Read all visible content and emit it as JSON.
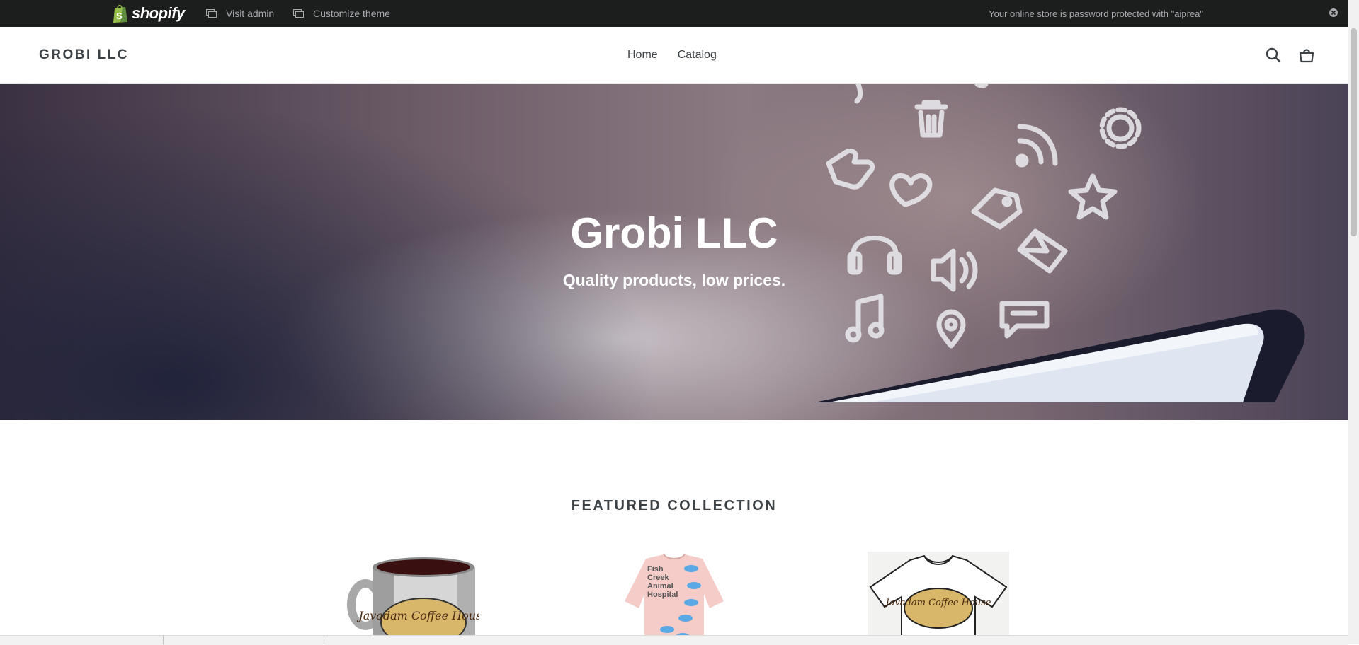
{
  "adminbar": {
    "brand": "shopify",
    "visit_admin": "Visit admin",
    "customize_theme": "Customize theme",
    "password_notice": "Your online store is password protected with \"aiprea\"",
    "close_icon": "close-icon"
  },
  "header": {
    "logo": "GROBI LLC",
    "nav": [
      "Home",
      "Catalog"
    ],
    "search_icon": "search-icon",
    "cart_icon": "cart-icon"
  },
  "hero": {
    "title": "Grobi LLC",
    "subtitle": "Quality products, low prices."
  },
  "featured": {
    "title": "FEATURED COLLECTION",
    "products": [
      {
        "name": "mug",
        "image_text": "Javadam Coffee House"
      },
      {
        "name": "sweatshirt",
        "image_text": [
          "Fish",
          "Creek",
          "Animal",
          "Hospital"
        ]
      },
      {
        "name": "t-shirt",
        "image_text": "Javadam Coffee House"
      }
    ]
  },
  "colors": {
    "adminbar_bg": "#1c1d1d",
    "text": "#3d4246",
    "hero_text": "#ffffff"
  }
}
